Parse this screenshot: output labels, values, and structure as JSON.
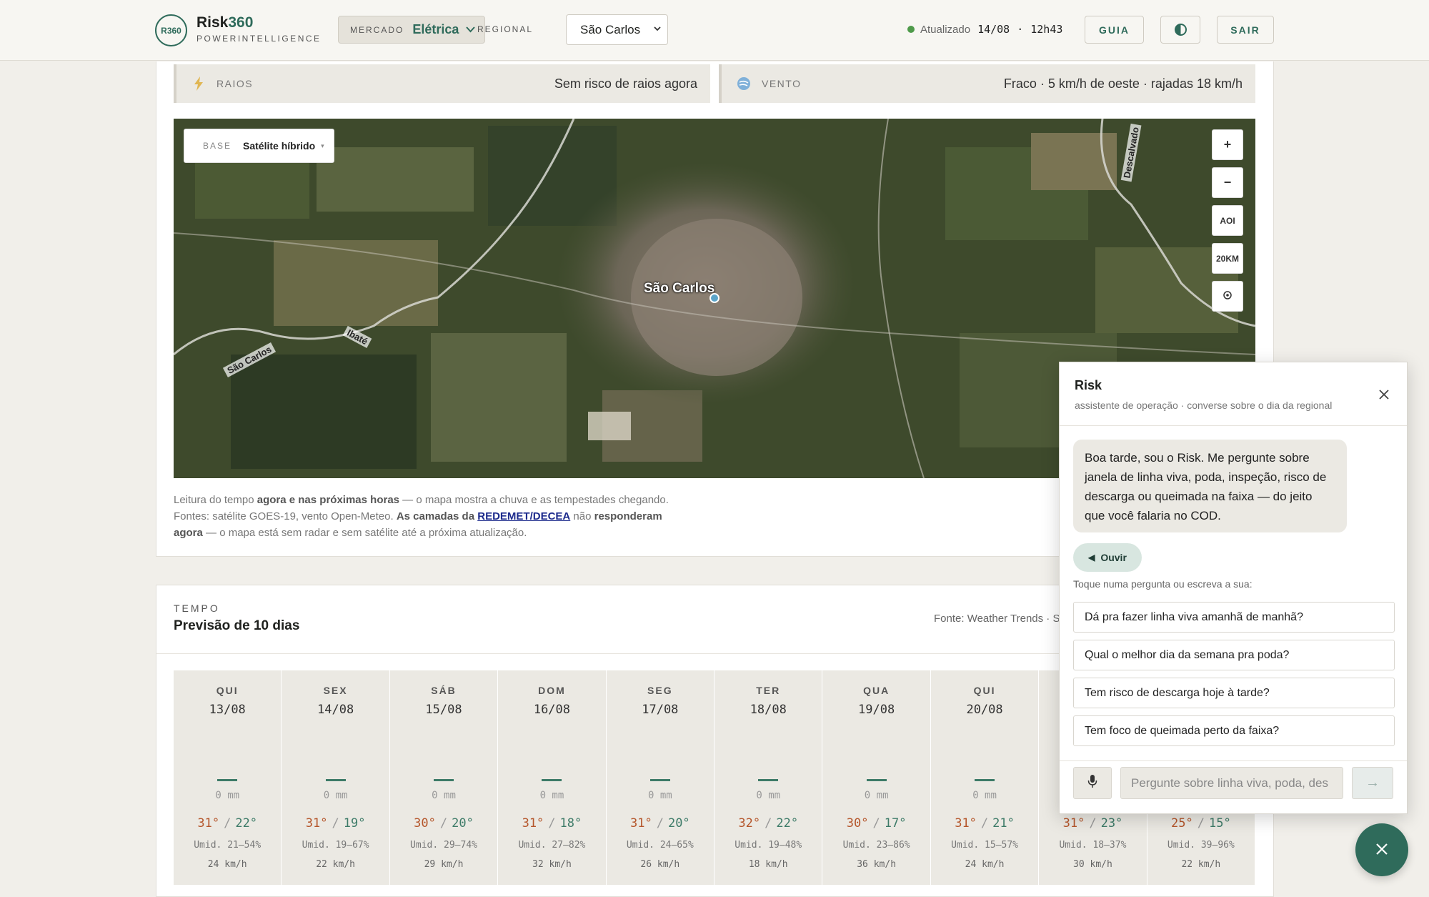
{
  "header": {
    "logo_mark": "R360",
    "brand_main": "Risk",
    "brand_accent": "360",
    "brand_sub": "POWERINTELLIGENCE",
    "market_label": "MERCADO",
    "market_value": "Elétrica",
    "regional_label": "REGIONAL",
    "regional_value": "São Carlos",
    "updated_label": "Atualizado",
    "updated_date": "14/08",
    "updated_sep": "·",
    "updated_time": "12h43",
    "guia_label": "GUIA",
    "sair_label": "SAIR",
    "status_color": "#4e9a4a",
    "accent_color": "#2f6b5b"
  },
  "alerts": {
    "raios": {
      "label": "RAIOS",
      "value": "Sem risco de raios agora",
      "icon": "lightning-icon"
    },
    "vento": {
      "label": "VENTO",
      "value": "Fraco · 5 km/h de oeste · rajadas 18 km/h",
      "icon": "wind-icon"
    }
  },
  "map": {
    "base_label": "BASE",
    "base_value": "Satélite híbrido",
    "city": "São Carlos",
    "place_labels": [
      "São Carlos",
      "Ibaté",
      "Descalvado"
    ],
    "zoom_in": "+",
    "zoom_out": "−",
    "aoi": "AOI",
    "radius": "20KM",
    "locate_icon": "target-icon"
  },
  "caption": {
    "p1": "Leitura do tempo ",
    "b1": "agora e nas próximas horas",
    "p2": " — o mapa mostra a chuva e as tempestades chegando. Fontes: satélite GOES-19, vento Open-Meteo. ",
    "b2": "As camadas da ",
    "link": "REDEMET/DECEA",
    "p3": " não ",
    "b3": "responderam agora",
    "p4": " — o mapa está sem radar e sem satélite até a próxima atualização."
  },
  "forecast": {
    "section_label": "TEMPO",
    "title": "Previsão de 10 dias",
    "source": "Fonte: Weather Trends · S",
    "days": [
      {
        "name": "QUI",
        "date": "13/08",
        "rain": "0 mm",
        "hi": "31°",
        "lo": "22°",
        "humidity": "Umid. 21–54%",
        "wind": "24 km/h"
      },
      {
        "name": "SEX",
        "date": "14/08",
        "rain": "0 mm",
        "hi": "31°",
        "lo": "19°",
        "humidity": "Umid. 19–67%",
        "wind": "22 km/h"
      },
      {
        "name": "SÁB",
        "date": "15/08",
        "rain": "0 mm",
        "hi": "30°",
        "lo": "20°",
        "humidity": "Umid. 29–74%",
        "wind": "29 km/h"
      },
      {
        "name": "DOM",
        "date": "16/08",
        "rain": "0 mm",
        "hi": "31°",
        "lo": "18°",
        "humidity": "Umid. 27–82%",
        "wind": "32 km/h"
      },
      {
        "name": "SEG",
        "date": "17/08",
        "rain": "0 mm",
        "hi": "31°",
        "lo": "20°",
        "humidity": "Umid. 24–65%",
        "wind": "26 km/h"
      },
      {
        "name": "TER",
        "date": "18/08",
        "rain": "0 mm",
        "hi": "32°",
        "lo": "22°",
        "humidity": "Umid. 19–48%",
        "wind": "18 km/h"
      },
      {
        "name": "QUA",
        "date": "19/08",
        "rain": "0 mm",
        "hi": "30°",
        "lo": "17°",
        "humidity": "Umid. 23–86%",
        "wind": "36 km/h"
      },
      {
        "name": "QUI",
        "date": "20/08",
        "rain": "0 mm",
        "hi": "31°",
        "lo": "21°",
        "humidity": "Umid. 15–57%",
        "wind": "24 km/h"
      },
      {
        "name": "",
        "date": "",
        "rain": "",
        "hi": "31°",
        "lo": "23°",
        "humidity": "Umid. 18–37%",
        "wind": "30 km/h"
      },
      {
        "name": "",
        "date": "",
        "rain": "",
        "hi": "25°",
        "lo": "15°",
        "humidity": "Umid. 39–96%",
        "wind": "22 km/h"
      }
    ]
  },
  "chat": {
    "title": "Risk",
    "subtitle": "assistente de operação · converse sobre o dia da regional",
    "greeting": "Boa tarde, sou o Risk. Me pergunte sobre janela de linha viva, poda, inspeção, risco de descarga ou queimada na faixa — do jeito que você falaria no COD.",
    "listen_label": "Ouvir",
    "prompt": "Toque numa pergunta ou escreva a sua:",
    "suggestions": [
      "Dá pra fazer linha viva amanhã de manhã?",
      "Qual o melhor dia da semana pra poda?",
      "Tem risco de descarga hoje à tarde?",
      "Tem foco de queimada perto da faixa?"
    ],
    "input_placeholder": "Pergunte sobre linha viva, poda, des",
    "send_icon": "arrow-right-icon",
    "mic_icon": "mic-icon"
  }
}
